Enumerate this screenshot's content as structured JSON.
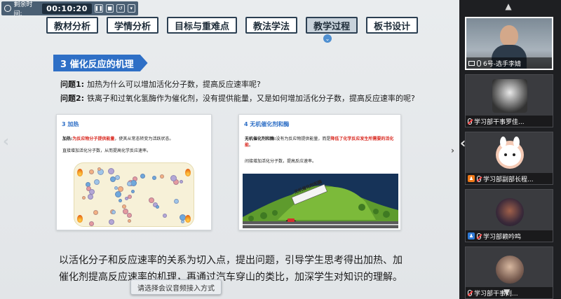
{
  "timer": {
    "label": "剩余时间:",
    "value": "00:10:20"
  },
  "nav": {
    "tabs": [
      {
        "label": "教材分析"
      },
      {
        "label": "学情分析"
      },
      {
        "label": "目标与重难点"
      },
      {
        "label": "教法学法"
      },
      {
        "label": "教学过程",
        "active": true
      },
      {
        "label": "板书设计"
      }
    ]
  },
  "slide": {
    "section_title": "3 催化反应的机理",
    "questions": [
      {
        "label": "问题1:",
        "text": "加热为什么可以增加活化分子数，提高反应速率呢?"
      },
      {
        "label": "问题2:",
        "text": "铁离子和过氧化氢酶作为催化剂，没有提供能量，又是如何增加活化分子数，提高反应速率的呢?"
      }
    ],
    "card_left": {
      "title": "3  加热",
      "line1_prefix": "加热:",
      "line1_highlight": "为反应物分子提供能量",
      "line1_suffix": "，使其从常态转变为活跃状态。",
      "line2": "直接增加活化分子数，从而提高化学反应速率。"
    },
    "card_right": {
      "title": "4  无机催化剂和酶",
      "line1_prefix": "无机催化剂和酶:",
      "line1_mid": "没有为反应物提供能量，而是",
      "line1_highlight": "降低了化学反应发生所需要的活化能",
      "line1_suffix": "。",
      "line2": "间接增加活化分子数，提高反应速率。",
      "sign": "无机催化剂和酶"
    },
    "subtitle": "以活化分子和反应速率的关系为切入点，提出问题，引导学生思考得出加热、加催化剂提高反应速率的机理，再通过汽车穿山的类比，加深学生对知识的理解。",
    "audio_prompt": "请选择会议音频接入方式"
  },
  "participants": [
    {
      "name": "6号-选手李婧",
      "mic_muted": false,
      "active": true
    },
    {
      "name": "学习部干事罗佳...",
      "mic_muted": true,
      "badge": ""
    },
    {
      "name": "学习部副部长程...",
      "mic_muted": true,
      "badge": "orange"
    },
    {
      "name": "学习部赖吟鸣",
      "mic_muted": true,
      "badge": "blue"
    },
    {
      "name": "学习部干事刘...",
      "mic_muted": true,
      "badge": ""
    }
  ],
  "colors": {
    "accent": "#2e6fc6",
    "highlight": "#d9281f",
    "tab_border": "#2b3f52"
  }
}
